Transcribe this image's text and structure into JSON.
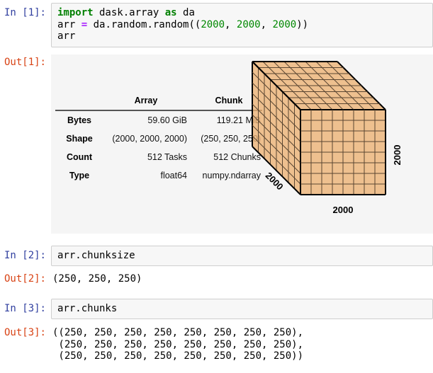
{
  "colors": {
    "input_prompt": "#303F9F",
    "output_prompt": "#D84315",
    "keyword": "#008000",
    "operator": "#AA22FF",
    "number": "#008800",
    "input_bg": "#F7F7F7",
    "input_border": "#CFCFCF",
    "output_bg": "#F5F5F5",
    "cube_fill": "#ECB172",
    "cube_line": "#5A4632",
    "cube_edge": "#000000"
  },
  "cell1": {
    "prompt": "In [1]:",
    "code": {
      "l1_kw1": "import",
      "l1_t1": " dask.array ",
      "l1_kw2": "as",
      "l1_t2": " da",
      "l2_t1": "arr ",
      "l2_op": "=",
      "l2_t2": " da.random.random((",
      "l2_n1": "2000",
      "l2_c1": ", ",
      "l2_n2": "2000",
      "l2_c2": ", ",
      "l2_n3": "2000",
      "l2_t3": "))",
      "l3": "arr"
    }
  },
  "out1": {
    "prompt": "Out[1]:",
    "table": {
      "col_blank": "",
      "col_array": "Array",
      "col_chunk": "Chunk",
      "rows": [
        {
          "label": "Bytes",
          "array": "59.60 GiB",
          "chunk": "119.21 MiB"
        },
        {
          "label": "Shape",
          "array": "(2000, 2000, 2000)",
          "chunk": "(250, 250, 250)"
        },
        {
          "label": "Count",
          "array": "512 Tasks",
          "chunk": "512 Chunks"
        },
        {
          "label": "Type",
          "array": "float64",
          "chunk": "numpy.ndarray"
        }
      ]
    },
    "cube": {
      "divisions": 8,
      "label_bottom": "2000",
      "label_right": "2000",
      "label_depth": "2000"
    }
  },
  "cell2": {
    "prompt": "In [2]:",
    "code": "arr.chunksize"
  },
  "out2": {
    "prompt": "Out[2]:",
    "value": "(250, 250, 250)"
  },
  "cell3": {
    "prompt": "In [3]:",
    "code": "arr.chunks"
  },
  "out3": {
    "prompt": "Out[3]:",
    "value": "((250, 250, 250, 250, 250, 250, 250, 250),\n (250, 250, 250, 250, 250, 250, 250, 250),\n (250, 250, 250, 250, 250, 250, 250, 250))"
  }
}
